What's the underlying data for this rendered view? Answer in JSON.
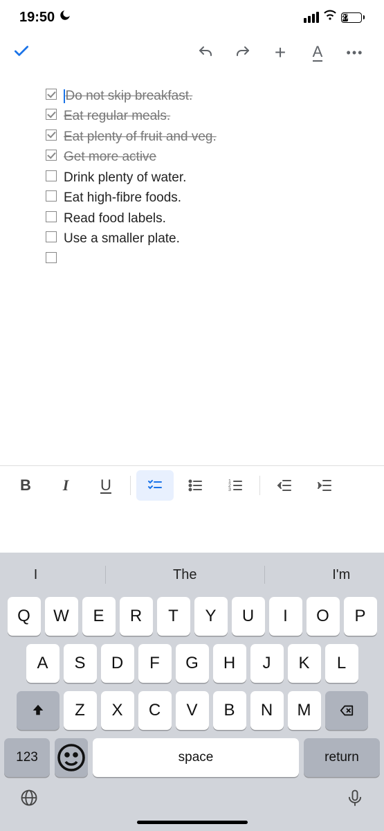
{
  "status": {
    "time": "19:50",
    "battery_pct": "27"
  },
  "toolbar": {
    "plus": "+",
    "A": "A",
    "dots": "•••"
  },
  "items": [
    {
      "text": "Do not skip breakfast.",
      "checked": true
    },
    {
      "text": "Eat regular meals.",
      "checked": true
    },
    {
      "text": "Eat plenty of fruit and veg.",
      "checked": true
    },
    {
      "text": "Get more active",
      "checked": true
    },
    {
      "text": "Drink plenty of water.",
      "checked": false
    },
    {
      "text": "Eat high-fibre foods.",
      "checked": false
    },
    {
      "text": "Read food labels.",
      "checked": false
    },
    {
      "text": "Use a smaller plate.",
      "checked": false
    },
    {
      "text": "",
      "checked": false
    }
  ],
  "format": {
    "B": "B",
    "I": "I",
    "U": "U"
  },
  "suggestions": [
    "I",
    "The",
    "I'm"
  ],
  "keys": {
    "row1": [
      "Q",
      "W",
      "E",
      "R",
      "T",
      "Y",
      "U",
      "I",
      "O",
      "P"
    ],
    "row2": [
      "A",
      "S",
      "D",
      "F",
      "G",
      "H",
      "J",
      "K",
      "L"
    ],
    "row3": [
      "Z",
      "X",
      "C",
      "V",
      "B",
      "N",
      "M"
    ],
    "num": "123",
    "space": "space",
    "return": "return"
  }
}
